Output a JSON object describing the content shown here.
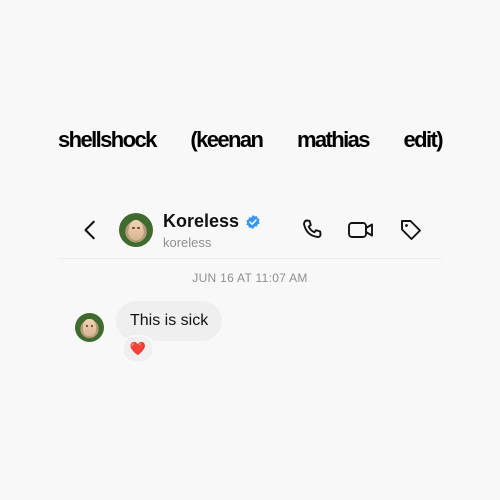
{
  "headline": {
    "words": [
      "shellshock",
      "(keenan",
      "mathias",
      "edit)"
    ]
  },
  "header": {
    "display_name": "Koreless",
    "username": "koreless",
    "verified": true,
    "icons": [
      "back-chevron-icon",
      "phone-icon",
      "video-camera-icon",
      "tag-icon"
    ]
  },
  "thread": {
    "timestamp": "JUN 16 AT 11:07 AM",
    "messages": [
      {
        "text": "This is sick",
        "reaction": "❤️"
      }
    ]
  },
  "colors": {
    "background": "#f8f8f8",
    "bubble": "#efefef",
    "verified_blue": "#3897f0",
    "muted_text": "#8e8e8e",
    "heart": "#e0245e"
  }
}
